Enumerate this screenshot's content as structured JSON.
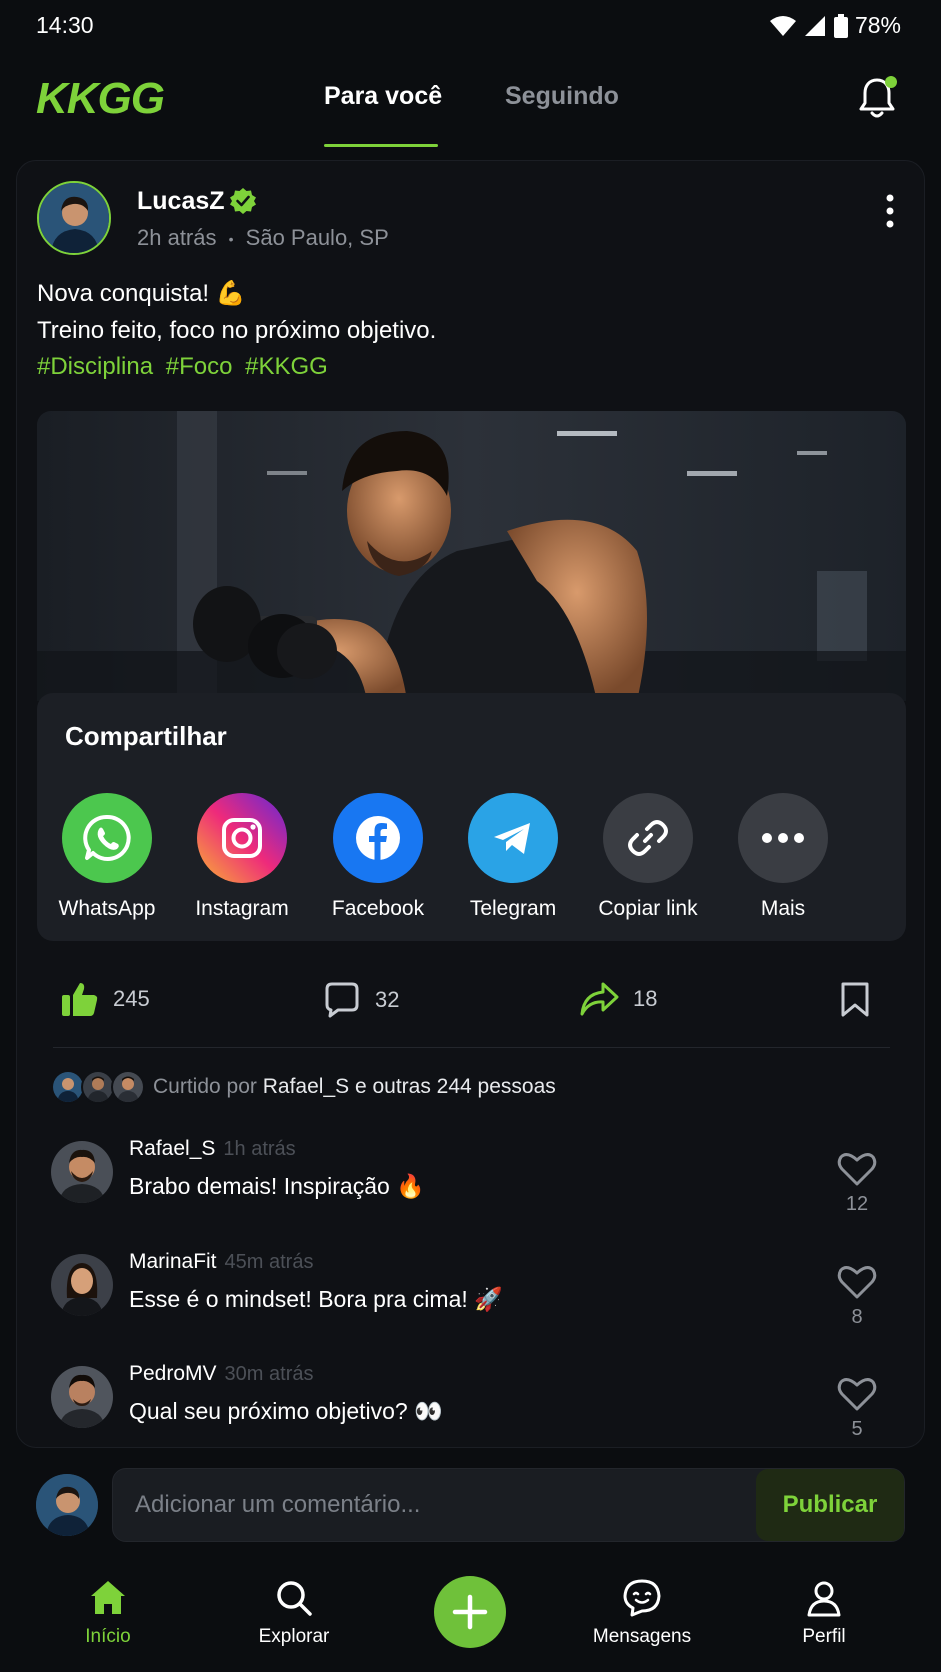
{
  "status_bar": {
    "time": "14:30",
    "battery": "78%"
  },
  "header": {
    "logo": "KKGG",
    "tabs": [
      {
        "label": "Para você",
        "active": true
      },
      {
        "label": "Seguindo",
        "active": false
      }
    ],
    "notification_icon": "bell-icon"
  },
  "post": {
    "author": "LucasZ",
    "time": "2h atrás",
    "separator": "•",
    "location": "São Paulo, SP",
    "text_line1": "Nova conquista! 💪",
    "text_line2": "Treino feito, foco no próximo objetivo.",
    "hashtags": [
      "#Disciplina",
      "#Foco",
      "#KKGG"
    ]
  },
  "share": {
    "title": "Compartilhar",
    "options": [
      {
        "label": "WhatsApp",
        "icon": "whatsapp-icon",
        "color": "#4cc74e"
      },
      {
        "label": "Instagram",
        "icon": "instagram-icon",
        "color": "#d6307a"
      },
      {
        "label": "Facebook",
        "icon": "facebook-icon",
        "color": "#1877f2"
      },
      {
        "label": "Telegram",
        "icon": "telegram-icon",
        "color": "#2aa3e6"
      },
      {
        "label": "Copiar link",
        "icon": "link-icon",
        "color": "#3a3d43"
      },
      {
        "label": "Mais",
        "icon": "more-icon",
        "color": "#3a3d43"
      }
    ]
  },
  "actions": {
    "likes": "245",
    "comments": "32",
    "shares": "18"
  },
  "liked_by": {
    "prefix": "Curtido por",
    "names": "Rafael_S e outras 244 pessoas"
  },
  "comments": [
    {
      "user": "Rafael_S",
      "time": "1h atrás",
      "text": "Brabo demais! Inspiração 🔥",
      "likes": "12"
    },
    {
      "user": "MarinaFit",
      "time": "45m atrás",
      "text": "Esse é o mindset! Bora pra cima! 🚀",
      "likes": "8"
    },
    {
      "user": "PedroMV",
      "time": "30m atrás",
      "text": "Qual seu próximo objetivo? 👀",
      "likes": "5"
    }
  ],
  "comment_input": {
    "placeholder": "Adicionar um comentário...",
    "publish": "Publicar"
  },
  "bottom_nav": [
    {
      "label": "Início",
      "active": true
    },
    {
      "label": "Explorar",
      "active": false
    },
    {
      "label": "Mensagens",
      "active": false
    },
    {
      "label": "Perfil",
      "active": false
    }
  ],
  "colors": {
    "accent": "#7ed23a",
    "background": "#0b0d10",
    "card": "#0f1115"
  }
}
